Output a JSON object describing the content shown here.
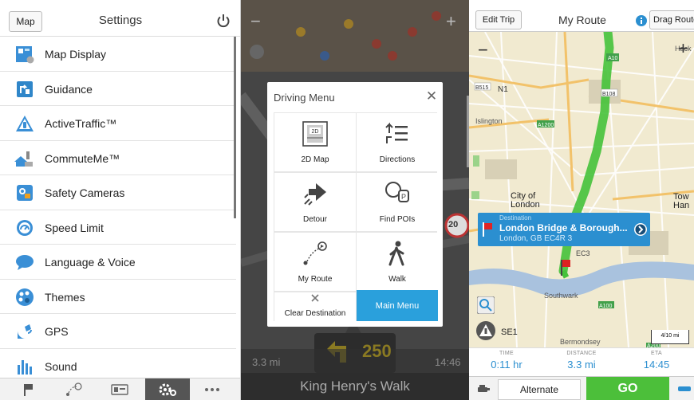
{
  "settings": {
    "map_button": "Map",
    "title": "Settings",
    "items": [
      {
        "label": "Map Display",
        "icon": "map-display-icon",
        "color": "#3a8fd6"
      },
      {
        "label": "Guidance",
        "icon": "guidance-icon",
        "color": "#3a8fd6"
      },
      {
        "label": "ActiveTraffic™",
        "icon": "traffic-icon",
        "color": "#3a8fd6"
      },
      {
        "label": "CommuteMe™",
        "icon": "commute-icon",
        "color": "#3a8fd6"
      },
      {
        "label": "Safety Cameras",
        "icon": "camera-icon",
        "color": "#3a8fd6"
      },
      {
        "label": "Speed Limit",
        "icon": "speed-icon",
        "color": "#3a8fd6"
      },
      {
        "label": "Language & Voice",
        "icon": "language-icon",
        "color": "#3a8fd6"
      },
      {
        "label": "Themes",
        "icon": "themes-icon",
        "color": "#3a8fd6"
      },
      {
        "label": "GPS",
        "icon": "gps-icon",
        "color": "#3a8fd6"
      },
      {
        "label": "Sound",
        "icon": "sound-icon",
        "color": "#3a8fd6"
      }
    ],
    "tabs": [
      "flag-icon",
      "route-icon",
      "card-icon",
      "settings-icon",
      "more-icon"
    ],
    "active_tab": "settings-icon"
  },
  "driving_menu": {
    "title": "Driving Menu",
    "items": [
      {
        "label": "2D Map",
        "icon": "map-2d-icon"
      },
      {
        "label": "Directions",
        "icon": "directions-icon"
      },
      {
        "label": "Detour",
        "icon": "detour-icon"
      },
      {
        "label": "Find POIs",
        "icon": "find-pois-icon"
      },
      {
        "label": "My Route",
        "icon": "my-route-icon"
      },
      {
        "label": "Walk",
        "icon": "walk-icon"
      },
      {
        "label": "Clear Destination",
        "icon": "clear-icon"
      },
      {
        "label": "Main Menu",
        "icon": ""
      }
    ],
    "background": {
      "distance_left": "3.3 mi",
      "distance_next": "250",
      "time_right": "14:46",
      "street": "King Henry's Walk",
      "speed_sign": "20"
    }
  },
  "route": {
    "edit_button": "Edit Trip",
    "title": "My Route",
    "drag_button": "Drag Route",
    "callout": {
      "kicker": "Destination",
      "title": "London Bridge & Borough...",
      "subtitle": "London, GB EC4R 3"
    },
    "map_labels": [
      "N1",
      "Islington",
      "City of London",
      "Southwark",
      "Bermondsey",
      "SE1",
      "EC3",
      "Hackney",
      "Tower Hamlets",
      "A10",
      "A1200",
      "A100",
      "A200",
      "B515",
      "B108"
    ],
    "stats": [
      {
        "key": "TIME",
        "value": "0:11 hr"
      },
      {
        "key": "DISTANCE",
        "value": "3.3 mi"
      },
      {
        "key": "ETA",
        "value": "14:45"
      }
    ],
    "scale": "4/10 mi",
    "alternate_button": "Alternate",
    "go_button": "GO"
  }
}
